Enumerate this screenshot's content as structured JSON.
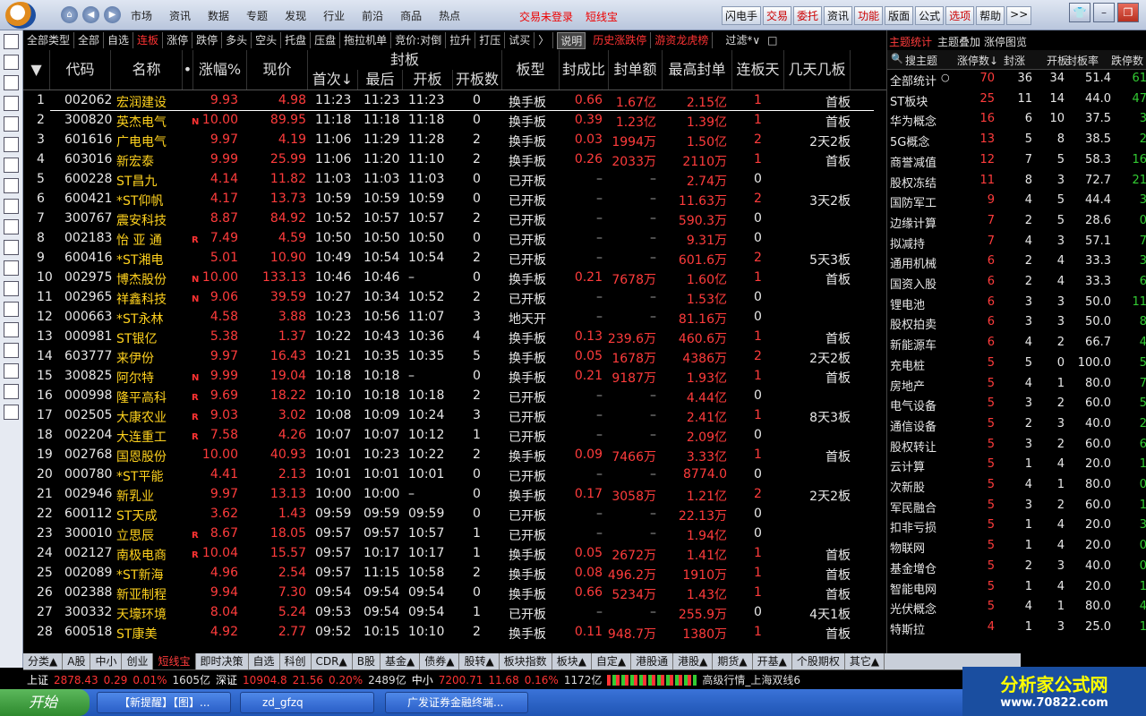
{
  "topbar": {
    "menu": [
      "市场",
      "资讯",
      "数据",
      "专题",
      "发现",
      "行业",
      "前沿",
      "商品",
      "热点"
    ],
    "login_status": "交易未登录",
    "mode": "短线宝",
    "quick": [
      "闪电手",
      "交易",
      "委托",
      "资讯",
      "功能",
      "版面",
      "公式",
      "选项",
      "帮助",
      ">>"
    ]
  },
  "catbar": {
    "items": [
      "全部类型",
      "全部",
      "自选",
      "连板",
      "涨停",
      "跌停",
      "多头",
      "空头",
      "托盘",
      "压盘",
      "拖拉机单",
      "竞价:对倒",
      "拉升",
      "打压",
      "试买",
      "〉"
    ],
    "selected": "连板",
    "explain": "说明",
    "history": "历史涨跌停",
    "hotmoney": "游资龙虎榜",
    "filter": "过滤*∨",
    "close": "□"
  },
  "columns": {
    "arrow": "▼",
    "code": "代码",
    "name": "名称",
    "dot": "•",
    "change": "涨幅%",
    "price": "现价",
    "seal_group": "封板",
    "first": "首次↓",
    "last": "最后",
    "open": "开板",
    "opencount": "开板数",
    "type": "板型",
    "ratio": "封成比",
    "amount": "封单额",
    "maxseal": "最高封单",
    "days": "连板天",
    "desc": "几天几板"
  },
  "rows": [
    [
      "1",
      "002062",
      "宏润建设",
      "",
      "9.93",
      "4.98",
      "11:23",
      "11:23",
      "11:23",
      "0",
      "换手板",
      "0.66",
      "1.67亿",
      "2.15亿",
      "1",
      "首板"
    ],
    [
      "2",
      "300820",
      "英杰电气",
      "N",
      "10.00",
      "89.95",
      "11:18",
      "11:18",
      "11:18",
      "0",
      "换手板",
      "0.39",
      "1.23亿",
      "1.39亿",
      "1",
      "首板"
    ],
    [
      "3",
      "601616",
      "广电电气",
      "",
      "9.97",
      "4.19",
      "11:06",
      "11:29",
      "11:28",
      "2",
      "换手板",
      "0.03",
      "1994万",
      "1.50亿",
      "2",
      "2天2板"
    ],
    [
      "4",
      "603016",
      "新宏泰",
      "",
      "9.99",
      "25.99",
      "11:06",
      "11:20",
      "11:10",
      "2",
      "换手板",
      "0.26",
      "2033万",
      "2110万",
      "1",
      "首板"
    ],
    [
      "5",
      "600228",
      "ST昌九",
      "",
      "4.14",
      "11.82",
      "11:03",
      "11:03",
      "11:03",
      "0",
      "已开板",
      "–",
      "–",
      "2.74万",
      "0",
      ""
    ],
    [
      "6",
      "600421",
      "*ST仰帆",
      "",
      "4.17",
      "13.73",
      "10:59",
      "10:59",
      "10:59",
      "0",
      "已开板",
      "–",
      "–",
      "11.63万",
      "2",
      "3天2板"
    ],
    [
      "7",
      "300767",
      "震安科技",
      "",
      "8.87",
      "84.92",
      "10:52",
      "10:57",
      "10:57",
      "2",
      "已开板",
      "–",
      "–",
      "590.3万",
      "0",
      ""
    ],
    [
      "8",
      "002183",
      "怡 亚 通",
      "R",
      "7.49",
      "4.59",
      "10:50",
      "10:50",
      "10:50",
      "0",
      "已开板",
      "–",
      "–",
      "9.31万",
      "0",
      ""
    ],
    [
      "9",
      "600416",
      "*ST湘电",
      "",
      "5.01",
      "10.90",
      "10:49",
      "10:54",
      "10:54",
      "2",
      "已开板",
      "–",
      "–",
      "601.6万",
      "2",
      "5天3板"
    ],
    [
      "10",
      "002975",
      "博杰股份",
      "N",
      "10.00",
      "133.13",
      "10:46",
      "10:46",
      "–",
      "0",
      "换手板",
      "0.21",
      "7678万",
      "1.60亿",
      "1",
      "首板"
    ],
    [
      "11",
      "002965",
      "祥鑫科技",
      "N",
      "9.06",
      "39.59",
      "10:27",
      "10:34",
      "10:52",
      "2",
      "已开板",
      "–",
      "–",
      "1.53亿",
      "0",
      ""
    ],
    [
      "12",
      "000663",
      "*ST永林",
      "",
      "4.58",
      "3.88",
      "10:23",
      "10:56",
      "11:07",
      "3",
      "地天开",
      "–",
      "–",
      "81.16万",
      "0",
      ""
    ],
    [
      "13",
      "000981",
      "ST银亿",
      "",
      "5.38",
      "1.37",
      "10:22",
      "10:43",
      "10:36",
      "4",
      "换手板",
      "0.13",
      "239.6万",
      "460.6万",
      "1",
      "首板"
    ],
    [
      "14",
      "603777",
      "来伊份",
      "",
      "9.97",
      "16.43",
      "10:21",
      "10:35",
      "10:35",
      "5",
      "换手板",
      "0.05",
      "1678万",
      "4386万",
      "2",
      "2天2板"
    ],
    [
      "15",
      "300825",
      "阿尔特",
      "N",
      "9.99",
      "19.04",
      "10:18",
      "10:18",
      "–",
      "0",
      "换手板",
      "0.21",
      "9187万",
      "1.93亿",
      "1",
      "首板"
    ],
    [
      "16",
      "000998",
      "隆平高科",
      "R",
      "9.69",
      "18.22",
      "10:10",
      "10:18",
      "10:18",
      "2",
      "已开板",
      "–",
      "–",
      "4.44亿",
      "0",
      ""
    ],
    [
      "17",
      "002505",
      "大康农业",
      "R",
      "9.03",
      "3.02",
      "10:08",
      "10:09",
      "10:24",
      "3",
      "已开板",
      "–",
      "–",
      "2.41亿",
      "1",
      "8天3板"
    ],
    [
      "18",
      "002204",
      "大连重工",
      "R",
      "7.58",
      "4.26",
      "10:07",
      "10:07",
      "10:12",
      "1",
      "已开板",
      "–",
      "–",
      "2.09亿",
      "0",
      ""
    ],
    [
      "19",
      "002768",
      "国恩股份",
      "",
      "10.00",
      "40.93",
      "10:01",
      "10:23",
      "10:22",
      "2",
      "换手板",
      "0.09",
      "7466万",
      "3.33亿",
      "1",
      "首板"
    ],
    [
      "20",
      "000780",
      "*ST平能",
      "",
      "4.41",
      "2.13",
      "10:01",
      "10:01",
      "10:01",
      "0",
      "已开板",
      "–",
      "–",
      "8774.0",
      "0",
      ""
    ],
    [
      "21",
      "002946",
      "新乳业",
      "",
      "9.97",
      "13.13",
      "10:00",
      "10:00",
      "–",
      "0",
      "换手板",
      "0.17",
      "3058万",
      "1.21亿",
      "2",
      "2天2板"
    ],
    [
      "22",
      "600112",
      "ST天成",
      "",
      "3.62",
      "1.43",
      "09:59",
      "09:59",
      "09:59",
      "0",
      "已开板",
      "–",
      "–",
      "22.13万",
      "0",
      ""
    ],
    [
      "23",
      "300010",
      "立思辰",
      "R",
      "8.67",
      "18.05",
      "09:57",
      "09:57",
      "10:57",
      "1",
      "已开板",
      "–",
      "–",
      "1.94亿",
      "0",
      ""
    ],
    [
      "24",
      "002127",
      "南极电商",
      "R",
      "10.04",
      "15.57",
      "09:57",
      "10:17",
      "10:17",
      "1",
      "换手板",
      "0.05",
      "2672万",
      "1.41亿",
      "1",
      "首板"
    ],
    [
      "25",
      "002089",
      "*ST新海",
      "",
      "4.96",
      "2.54",
      "09:57",
      "11:15",
      "10:58",
      "2",
      "换手板",
      "0.08",
      "496.2万",
      "1910万",
      "1",
      "首板"
    ],
    [
      "26",
      "002388",
      "新亚制程",
      "",
      "9.94",
      "7.30",
      "09:54",
      "09:54",
      "09:54",
      "0",
      "换手板",
      "0.66",
      "5234万",
      "1.43亿",
      "1",
      "首板"
    ],
    [
      "27",
      "300332",
      "天壕环境",
      "",
      "8.04",
      "5.24",
      "09:53",
      "09:54",
      "09:54",
      "1",
      "已开板",
      "–",
      "–",
      "255.9万",
      "0",
      "4天1板"
    ],
    [
      "28",
      "600518",
      "ST康美",
      "",
      "4.92",
      "2.77",
      "09:52",
      "10:15",
      "10:10",
      "2",
      "换手板",
      "0.11",
      "948.7万",
      "1380万",
      "1",
      "首板"
    ]
  ],
  "rightpanel": {
    "tab1": "主题统计",
    "tab2": "主题叠加",
    "tab3": "涨停图览",
    "search": "搜主题",
    "h_up": "涨停数↓",
    "h_seal": "封涨",
    "h_open": "开板",
    "h_rate": "封板率",
    "h_down": "跌停数",
    "rows": [
      [
        "全部统计",
        "70",
        "36",
        "34",
        "51.4",
        "61"
      ],
      [
        "ST板块",
        "25",
        "11",
        "14",
        "44.0",
        "47"
      ],
      [
        "华为概念",
        "16",
        "6",
        "10",
        "37.5",
        "3"
      ],
      [
        "5G概念",
        "13",
        "5",
        "8",
        "38.5",
        "2"
      ],
      [
        "商誉减值",
        "12",
        "7",
        "5",
        "58.3",
        "16"
      ],
      [
        "股权冻结",
        "11",
        "8",
        "3",
        "72.7",
        "21"
      ],
      [
        "国防军工",
        "9",
        "4",
        "5",
        "44.4",
        "3"
      ],
      [
        "边缘计算",
        "7",
        "2",
        "5",
        "28.6",
        "0"
      ],
      [
        "拟减持",
        "7",
        "4",
        "3",
        "57.1",
        "7"
      ],
      [
        "通用机械",
        "6",
        "2",
        "4",
        "33.3",
        "3"
      ],
      [
        "国资入股",
        "6",
        "2",
        "4",
        "33.3",
        "6"
      ],
      [
        "锂电池",
        "6",
        "3",
        "3",
        "50.0",
        "11"
      ],
      [
        "股权拍卖",
        "6",
        "3",
        "3",
        "50.0",
        "8"
      ],
      [
        "新能源车",
        "6",
        "4",
        "2",
        "66.7",
        "4"
      ],
      [
        "充电桩",
        "5",
        "5",
        "0",
        "100.0",
        "5"
      ],
      [
        "房地产",
        "5",
        "4",
        "1",
        "80.0",
        "7"
      ],
      [
        "电气设备",
        "5",
        "3",
        "2",
        "60.0",
        "5"
      ],
      [
        "通信设备",
        "5",
        "2",
        "3",
        "40.0",
        "2"
      ],
      [
        "股权转让",
        "5",
        "3",
        "2",
        "60.0",
        "6"
      ],
      [
        "云计算",
        "5",
        "1",
        "4",
        "20.0",
        "1"
      ],
      [
        "次新股",
        "5",
        "4",
        "1",
        "80.0",
        "0"
      ],
      [
        "军民融合",
        "5",
        "3",
        "2",
        "60.0",
        "1"
      ],
      [
        "扣非亏损",
        "5",
        "1",
        "4",
        "20.0",
        "3"
      ],
      [
        "物联网",
        "5",
        "1",
        "4",
        "20.0",
        "0"
      ],
      [
        "基金增仓",
        "5",
        "2",
        "3",
        "40.0",
        "0"
      ],
      [
        "智能电网",
        "5",
        "1",
        "4",
        "20.0",
        "1"
      ],
      [
        "光伏概念",
        "5",
        "4",
        "1",
        "80.0",
        "4"
      ],
      [
        "特斯拉",
        "4",
        "1",
        "3",
        "25.0",
        "1"
      ]
    ]
  },
  "tabbar": [
    "分类▲",
    "A股",
    "中小",
    "创业",
    "短线宝",
    "即时决策",
    "自选",
    "科创",
    "CDR▲",
    "B股",
    "基金▲",
    "债券▲",
    "股转▲",
    "板块指数",
    "板块▲",
    "自定▲",
    "港股通",
    "港股▲",
    "期货▲",
    "开基▲",
    "个股期权",
    "其它▲"
  ],
  "tabbar_active": "短线宝",
  "ticker": {
    "sh_label": "上证",
    "sh_val": "2878.43",
    "sh_chg": "0.29",
    "sh_pct": "0.01%",
    "sh_amt": "1605亿",
    "sz_label": "深证",
    "sz_val": "10904.8",
    "sz_chg": "21.56",
    "sz_pct": "0.20%",
    "sz_amt": "2489亿",
    "zx_label": "中小",
    "zx_val": "7200.71",
    "zx_chg": "11.68",
    "zx_pct": "0.16%",
    "zx_amt": "1172亿",
    "feed": "高级行情_上海双线6"
  },
  "taskbar": {
    "start": "开始",
    "t1": "【新提醒】【图】...",
    "t2": "zd_gfzq",
    "t3": "广发证券金融终端..."
  },
  "watermark": {
    "title": "分析家公式网",
    "url": "www.70822.com"
  }
}
